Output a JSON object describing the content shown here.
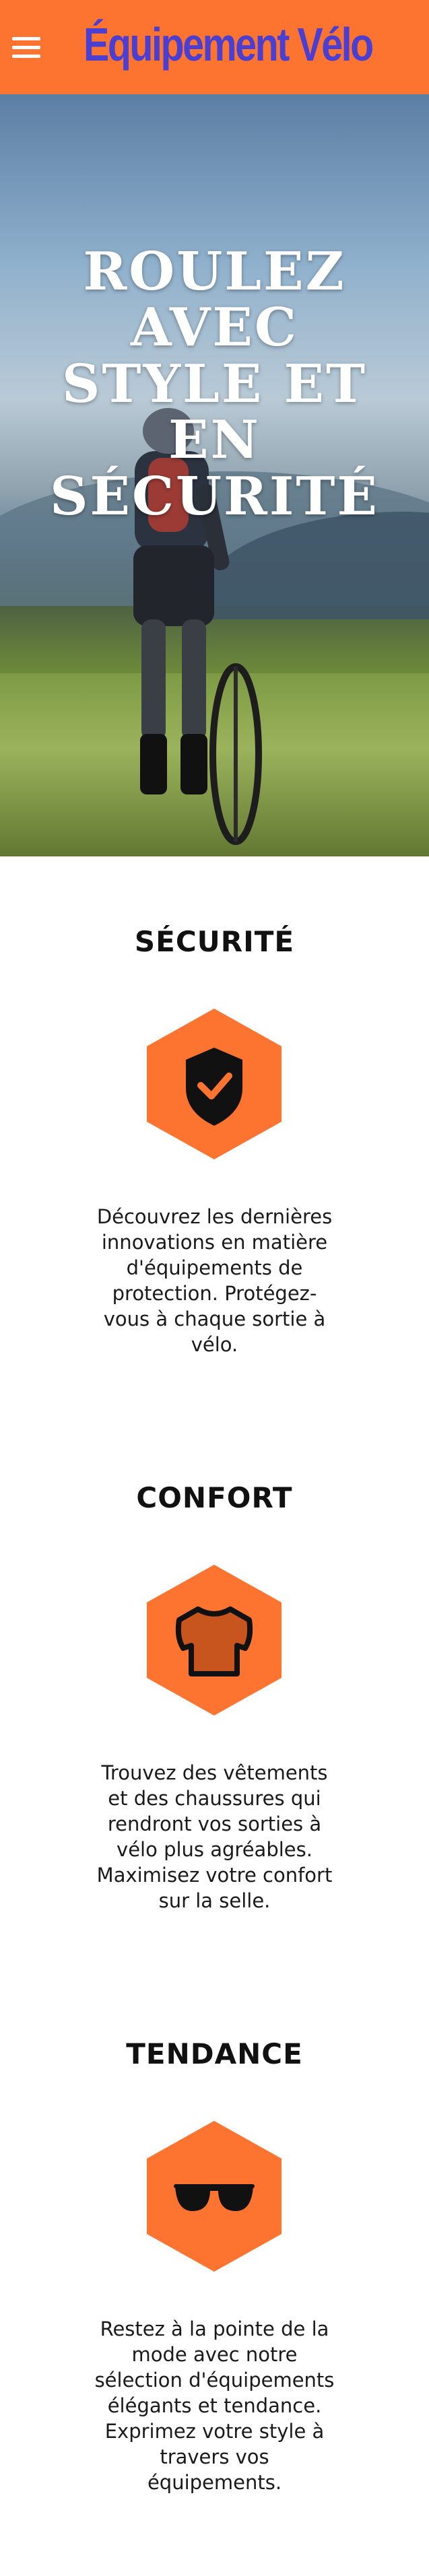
{
  "header": {
    "brand": "Équipement Vélo",
    "menu_icon": "hamburger-menu-icon",
    "background": "#fc7430",
    "brand_color": "#4b3fd1"
  },
  "hero": {
    "title_lines": [
      "ROULEZ",
      "AVEC",
      "STYLE ET",
      "EN",
      "SÉCURITÉ"
    ]
  },
  "features": [
    {
      "title": "SÉCURITÉ",
      "icon": "shield-check-icon",
      "text": "Découvrez les dernières innovations en matière d'équipements de protection. Protégez-vous à chaque sortie à vélo."
    },
    {
      "title": "CONFORT",
      "icon": "tshirt-icon",
      "text": "Trouvez des vêtements et des chaussures qui rendront vos sorties à vélo plus agréables. Maximisez votre confort sur la selle."
    },
    {
      "title": "TENDANCE",
      "icon": "sunglasses-icon",
      "text": "Restez à la pointe de la mode avec notre sélection d'équipements élégants et tendance. Exprimez votre style à travers vos équipements."
    }
  ],
  "accent": "#fc7430"
}
